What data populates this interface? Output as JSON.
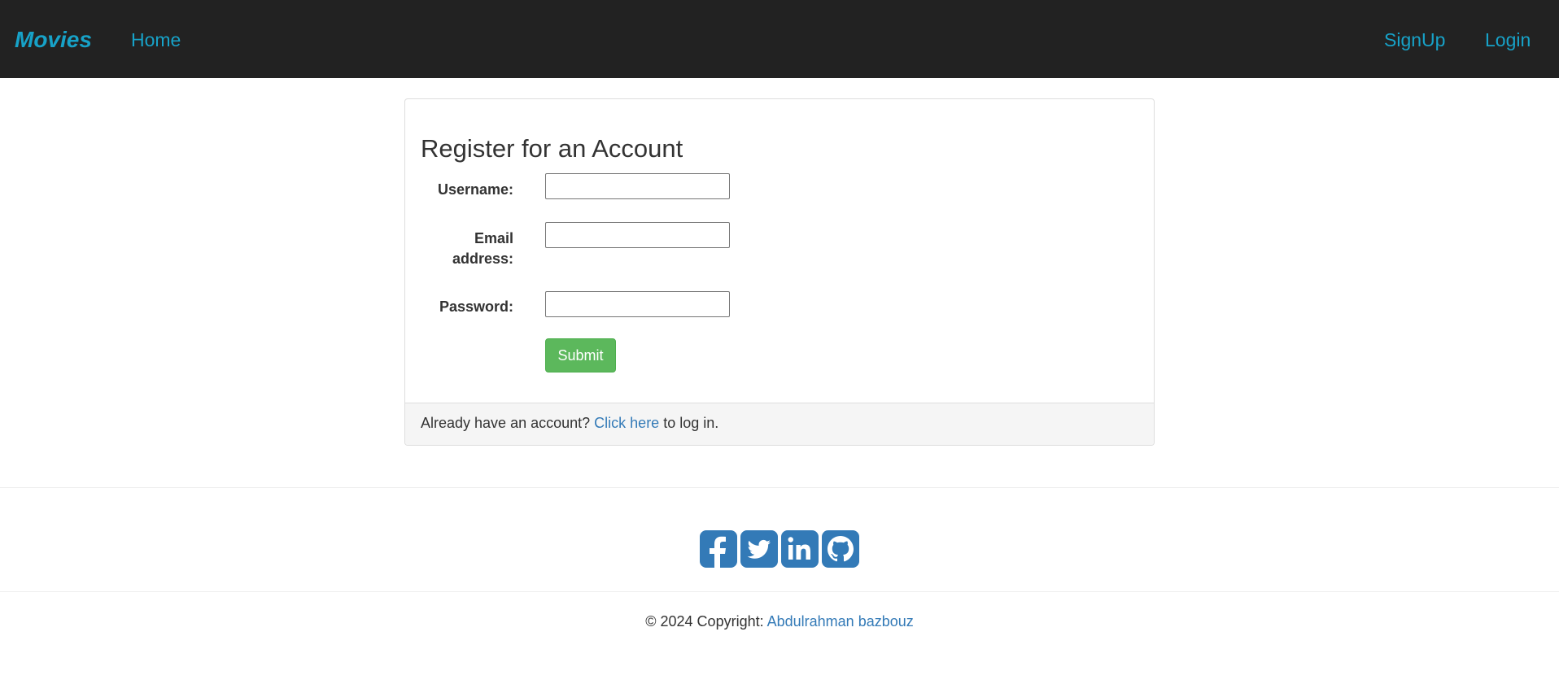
{
  "navbar": {
    "brand": "Movies",
    "home": "Home",
    "signup": "SignUp",
    "login": "Login",
    "link_color": "#17a2c8",
    "background": "#222222"
  },
  "register_card": {
    "title": "Register for an Account",
    "username_label": "Username:",
    "email_label_line1": "Email",
    "email_label_line2": "address:",
    "password_label": "Password:",
    "username_value": "",
    "email_value": "",
    "password_value": "",
    "submit_label": "Submit",
    "submit_color": "#5cb85c",
    "footer_prefix": "Already have an account?",
    "footer_link": "Click here",
    "footer_suffix": "to log in."
  },
  "social": {
    "icons": [
      "facebook-icon",
      "twitter-icon",
      "linkedin-icon",
      "github-icon"
    ],
    "color": "#337ab7"
  },
  "copyright": {
    "prefix": "© 2024 Copyright:",
    "author": "Abdulrahman bazbouz"
  }
}
